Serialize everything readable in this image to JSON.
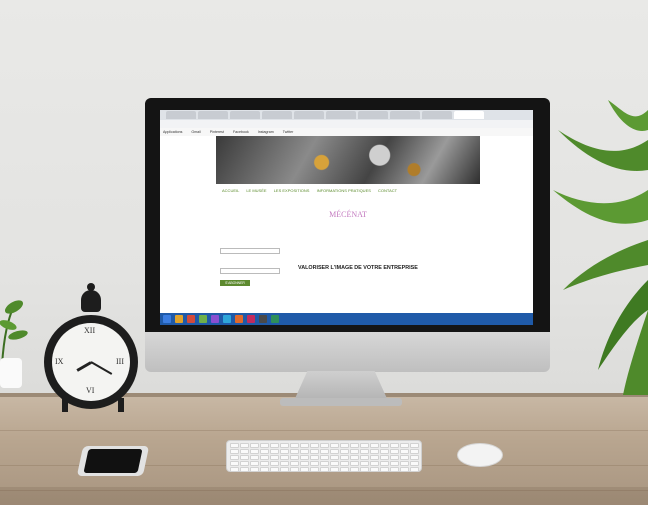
{
  "browser": {
    "tabs": [
      "",
      "",
      "",
      "",
      "",
      "",
      "",
      "",
      "",
      ""
    ],
    "address": "",
    "bookmarks": [
      "Applications",
      "Gmail",
      "Pinterest",
      "Facebook",
      "Instagram",
      "Twitter",
      "",
      "",
      "",
      ""
    ]
  },
  "website": {
    "nav": [
      "ACCUEIL",
      "LE MUSÉE",
      "LES EXPOSITIONS",
      "INFORMATIONS PRATIQUES",
      "CONTACT"
    ],
    "page_title": "MÉCÉNAT",
    "heading": "VALORISER L'IMAGE DE VOTRE ENTREPRISE",
    "sidebar_button": "S'ABONNER"
  },
  "clock": {
    "numerals": [
      "XII",
      "III",
      "VI",
      "IX"
    ]
  },
  "colors": {
    "wall": "#e6e6e4",
    "desk": "#b9a690",
    "taskbar": "#1f5aa8",
    "nav_green": "#5a8a2a",
    "title_pink": "#c47bc0",
    "plant_green": "#4f8a2b"
  }
}
